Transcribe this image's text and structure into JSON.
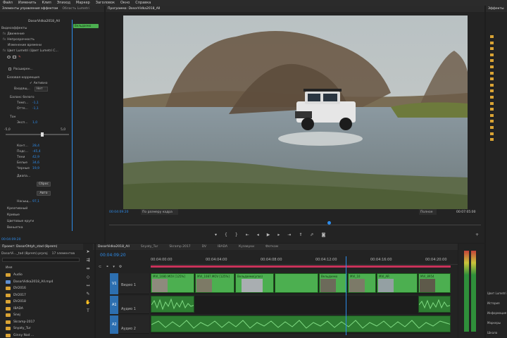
{
  "menu": [
    "Файл",
    "Изменить",
    "Клип",
    "Эпизод",
    "Маркер",
    "Заголовок",
    "Окно",
    "Справка"
  ],
  "effects_panel": {
    "tabs": [
      "Элементы управления эффектом",
      "Область Lumetri"
    ],
    "clip_name": "DosorVidka2018_All",
    "timeline_clip": "Вельдаемо",
    "section_video": "Видеоэффекты",
    "items": [
      "Движение",
      "Непрозрачность",
      "Изменение времени",
      "Цвет Lumetri (Цвет Lumetri C..."
    ],
    "high_dynamic": "Расширен...",
    "basic_correction": "Базовая коррекция",
    "active_label": "Активно",
    "input_lut_label": "Входящ...",
    "input_lut_value": "Нет",
    "wb_label": "Баланс белого",
    "temp_label": "Темп...",
    "temp_value": "-1,1",
    "tint_label": "Отте...",
    "tint_value": "-1,1",
    "tone_label": "Тон",
    "exposure_label": "Эксп...",
    "exposure_value": "1,0",
    "slider_min": "-5,0",
    "slider_max": "5,0",
    "tone_items": [
      {
        "label": "Конт...",
        "value": "28,4"
      },
      {
        "label": "Подс...",
        "value": "-45,4"
      },
      {
        "label": "Тени",
        "value": "42,9"
      },
      {
        "label": "Белые",
        "value": "34,6"
      },
      {
        "label": "Черные",
        "value": "19,9"
      }
    ],
    "hdr_label": "Диапа...",
    "reset_button": "Сброс",
    "auto_button": "Авто",
    "saturation_label": "Насыщ...",
    "saturation_value": "97,1",
    "creative": "Креативный",
    "curves": "Кривые",
    "color_wheels": "Цветовые круги",
    "vignette": "Виньетка",
    "timecode": "00:04:09:20"
  },
  "program_monitor": {
    "tab": "Программа: DosorVidka2018_All",
    "timecode": "00:04:09:20",
    "fit_label": "По размеру кадра",
    "quality": "Полное",
    "duration": "00:07:05:00"
  },
  "project_panel": {
    "tab": "Проект: DosorOhtyh_stad (8prem)",
    "file_name": "DosorVi..._tad (8prem).prproj",
    "item_count": "17 элементов",
    "column_name": "Имя",
    "items": [
      "Audio",
      "DosorVidka2018_All.mp4",
      "DV2016",
      "DV2017",
      "DV2018",
      "IBADA",
      "Snej",
      "Skramp-2017",
      "Snyaty_Tur",
      "Ginny Nad ..."
    ]
  },
  "timeline": {
    "tab": "DosorVidka2018_All",
    "other_tabs": [
      "Snyaty_Tur",
      "Skramp 2017",
      "DV",
      "IBADA",
      "Кузавуки",
      "Фоткам"
    ],
    "timecode": "00:04:09:20",
    "ruler": [
      "00:04:00:00",
      "00:04:04:00",
      "00:04:08:00",
      "00:04:12:00",
      "00:04:16:00",
      "00:04:20:00"
    ],
    "tracks": [
      {
        "id": "V1",
        "name": "Видео 1"
      },
      {
        "id": "A1",
        "name": "Аудио 1"
      },
      {
        "id": "A2",
        "name": "Аудио 2"
      }
    ],
    "video_clips": [
      {
        "label": "MVI_1080.MOV [125%]"
      },
      {
        "label": "MVI_1087.MOV [125%]"
      },
      {
        "label": "Вельдаемо(упаз)"
      },
      {
        "label": ""
      },
      {
        "label": "Вельдаемо"
      },
      {
        "label": "MVI_10"
      },
      {
        "label": "MVI_AR"
      },
      {
        "label": "MVI_8954"
      }
    ]
  },
  "effects_right": {
    "tab": "Эффекты",
    "list": [
      "",
      "",
      "",
      "",
      "",
      "",
      "",
      "",
      "",
      "",
      "",
      "",
      "",
      "",
      "",
      "",
      "",
      ""
    ],
    "bottom_items": [
      "Цвет Lumetri",
      "История",
      "Информация",
      "Маркеры",
      "Шкала"
    ]
  },
  "colors": {
    "accent": "#2d8ceb",
    "clip_green": "#4caf50",
    "audio_green": "#2e7d32",
    "folder": "#d9a334"
  }
}
